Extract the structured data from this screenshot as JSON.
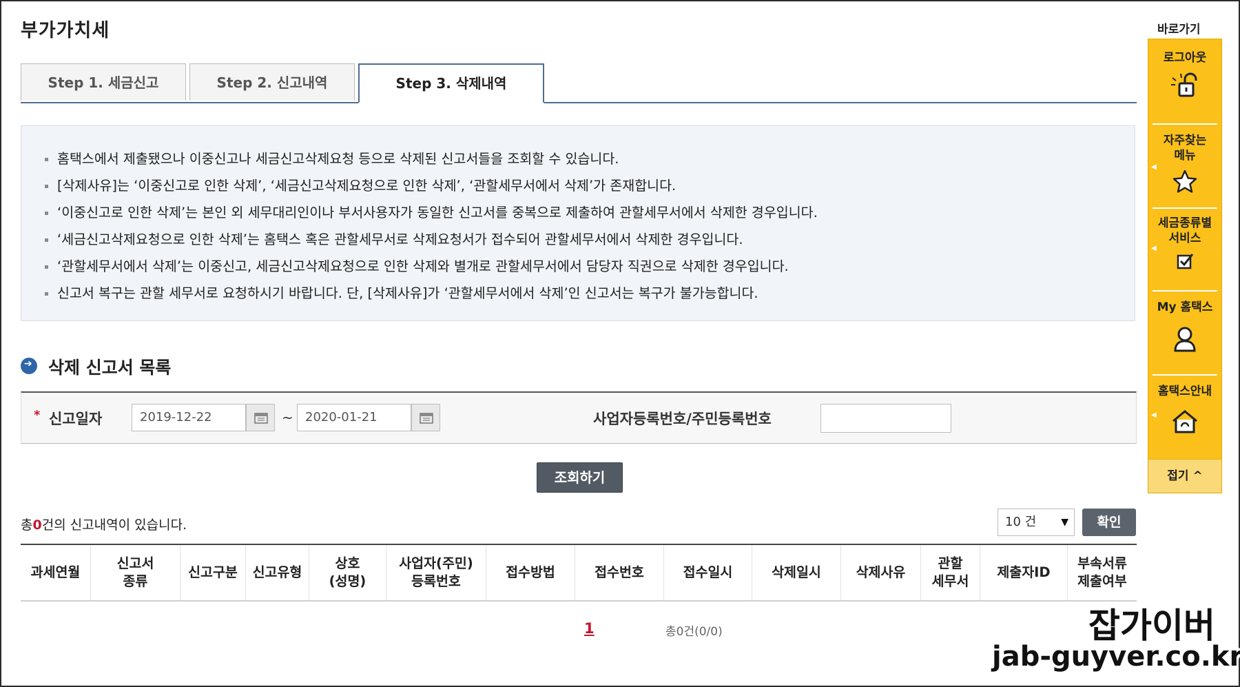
{
  "page": {
    "title": "부가가치세"
  },
  "tabs": [
    {
      "label": "Step 1. 세금신고"
    },
    {
      "label": "Step 2. 신고내역"
    },
    {
      "label": "Step 3. 삭제내역"
    }
  ],
  "info": {
    "items": [
      "홈택스에서 제출됐으나 이중신고나 세금신고삭제요청 등으로 삭제된 신고서들을 조회할 수 있습니다.",
      "[삭제사유]는 ‘이중신고로 인한 삭제’, ‘세금신고삭제요청으로 인한 삭제’, ‘관할세무서에서 삭제’가 존재합니다.",
      "‘이중신고로 인한 삭제’는 본인 외 세무대리인이나 부서사용자가 동일한 신고서를 중복으로 제출하여 관할세무서에서 삭제한 경우입니다.",
      "‘세금신고삭제요청으로 인한 삭제’는 홈택스 혹은 관할세무서로 삭제요청서가 접수되어 관할세무서에서 삭제한 경우입니다.",
      "‘관할세무서에서 삭제’는 이중신고, 세금신고삭제요청으로 인한 삭제와 별개로 관할세무서에서 담당자 직권으로 삭제한 경우입니다.",
      "신고서 복구는 관할 세무서로 요청하시기 바랍니다. 단, [삭제사유]가 ‘관할세무서에서 삭제’인 신고서는 복구가 불가능합니다."
    ]
  },
  "section": {
    "title": "삭제 신고서 목록"
  },
  "search": {
    "required_mark": "*",
    "date_label": "신고일자",
    "date_from": "2019-12-22",
    "separator": "~",
    "date_to": "2020-01-21",
    "biz_label": "사업자등록번호/주민등록번호",
    "biz_value": "",
    "submit_label": "조회하기"
  },
  "result": {
    "prefix": "총",
    "count": "0",
    "suffix": "건의 신고내역이 있습니다.",
    "page_size": "10 건",
    "page_size_arrow": "▼",
    "confirm_label": "확인"
  },
  "table": {
    "columns": [
      [
        "과세연월"
      ],
      [
        "신고서",
        "종류"
      ],
      [
        "신고구분"
      ],
      [
        "신고유형"
      ],
      [
        "상호",
        "(성명)"
      ],
      [
        "사업자(주민)",
        "등록번호"
      ],
      [
        "접수방법"
      ],
      [
        "접수번호"
      ],
      [
        "접수일시"
      ],
      [
        "삭제일시"
      ],
      [
        "삭제사유"
      ],
      [
        "관할",
        "세무서"
      ],
      [
        "제출자ID"
      ],
      [
        "부속서류",
        "제출여부"
      ]
    ]
  },
  "pagination": {
    "current": "1",
    "total": "총0건(0/0)"
  },
  "quick_menu": {
    "title": "바로가기",
    "items": [
      {
        "label_lines": [
          "로그아웃"
        ],
        "icon": "unlock-icon"
      },
      {
        "label_lines": [
          "자주찾는",
          "메뉴"
        ],
        "icon": "star-icon"
      },
      {
        "label_lines": [
          "세금종류별",
          "서비스"
        ],
        "icon": "checkbox-icon"
      },
      {
        "label_lines": [
          "My 홈택스"
        ],
        "icon": "user-icon"
      },
      {
        "label_lines": [
          "홈택스안내"
        ],
        "icon": "home-icon"
      }
    ],
    "fold_label": "접기 ^"
  },
  "watermark": {
    "line1": "잡가이버",
    "line2": "jab-guyver.co.kr"
  },
  "colors": {
    "accent": "#4d6d8f",
    "quick_menu": "#fbc01a",
    "alert": "#c0182f",
    "button": "#525a64"
  }
}
